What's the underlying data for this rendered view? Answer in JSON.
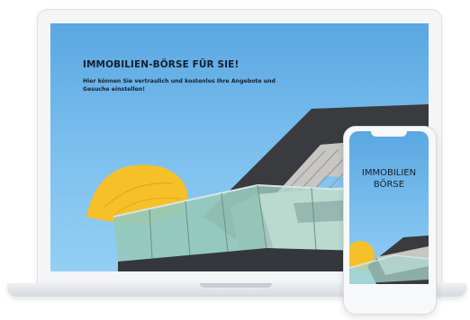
{
  "laptop": {
    "hero_title": "IMMOBILIEN-BÖRSE FÜR SIE!",
    "hero_subtitle": "Hier können Sie vertraulich und kostenlos Ihre Angebote und Gesuche einstellen!"
  },
  "phone": {
    "title_line1": "IMMOBILIEN",
    "title_line2": "BÖRSE"
  },
  "colors": {
    "sky": "#7ec1ef",
    "umbrella": "#f6c028",
    "text": "#14202c"
  }
}
